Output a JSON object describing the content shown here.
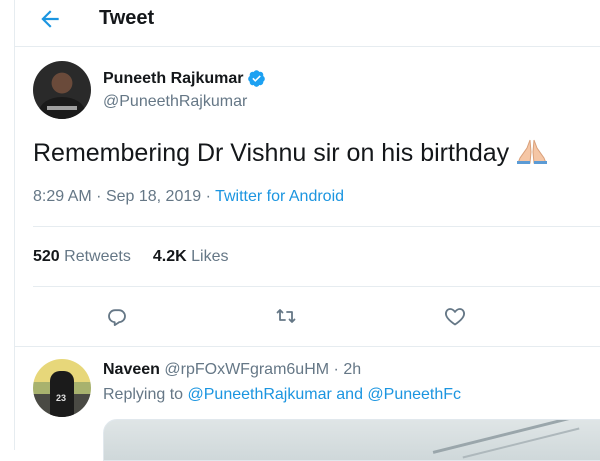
{
  "header": {
    "title": "Tweet",
    "back_icon": "arrow-left-icon"
  },
  "tweet": {
    "display_name": "Puneeth Rajkumar",
    "handle": "@PuneethRajkumar",
    "verified_icon": "verified-badge-icon",
    "text": "Remembering Dr Vishnu sir on his birthday",
    "emoji": "folded-hands-emoji",
    "time": "8:29 AM",
    "date": "Sep 18, 2019",
    "separator": "·",
    "source": "Twitter for Android",
    "retweets_count": "520",
    "retweets_label": "Retweets",
    "likes_count": "4.2K",
    "likes_label": "Likes",
    "actions": [
      "reply-icon",
      "retweet-icon",
      "like-icon"
    ]
  },
  "reply": {
    "display_name": "Naveen",
    "handle": "@rpFOxWFgram6uHM",
    "separator": "·",
    "time": "2h",
    "replying_prefix": "Replying to",
    "mention1": "@PuneethRajkumar",
    "and": "and",
    "mention2": "@PuneethFc",
    "avatar_number": "23"
  },
  "colors": {
    "accent": "#1b95e0",
    "text": "#14171a",
    "secondary": "#657786",
    "border": "#e6ecf0"
  }
}
